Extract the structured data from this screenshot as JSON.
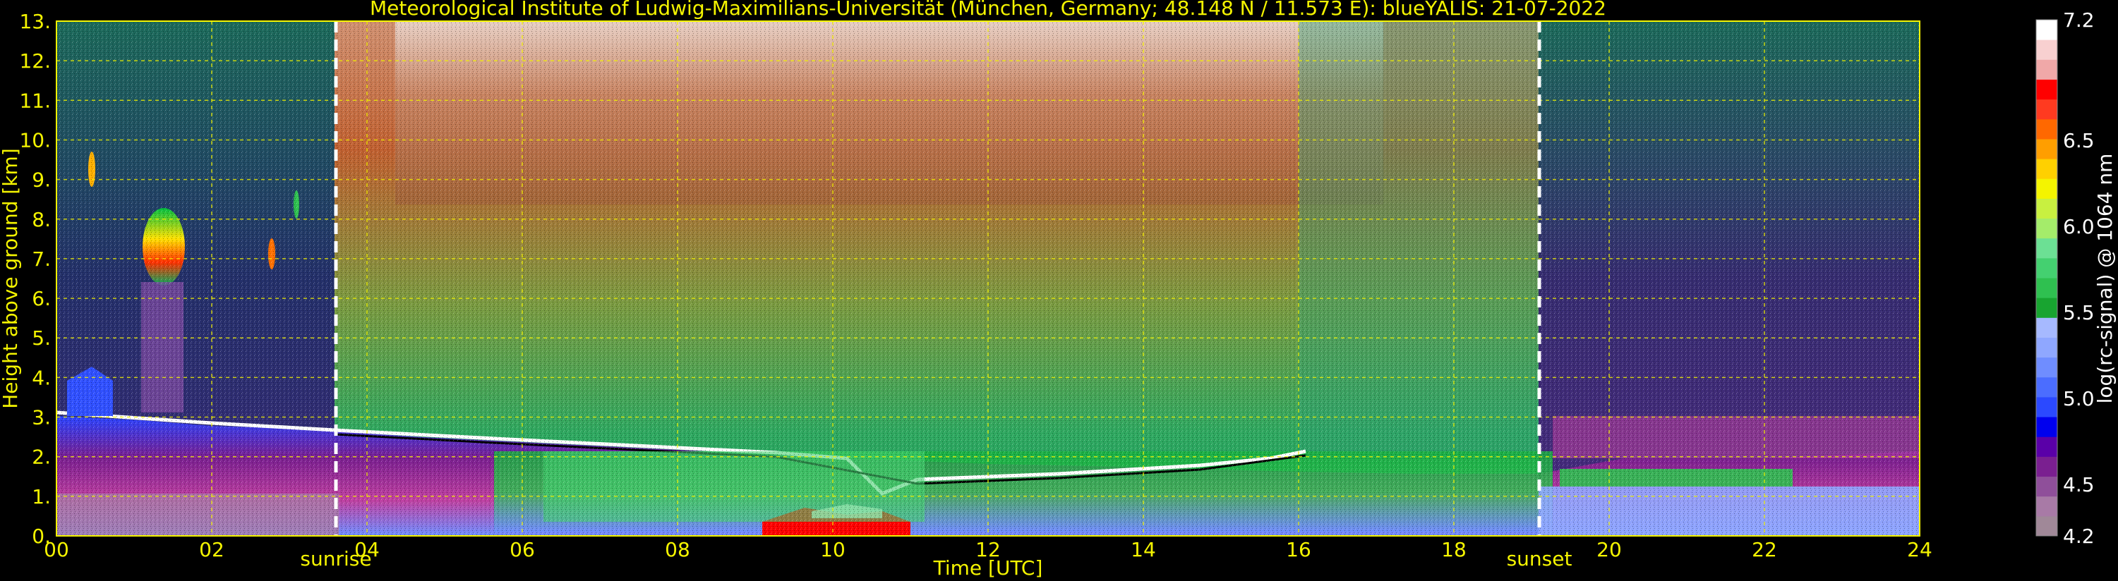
{
  "chart_data": {
    "type": "heatmap",
    "title": "Meteorological Institute of Ludwig-Maximilians-Universität (München, Germany; 48.148 N / 11.573 E):     blueYALIS: 21-07-2022",
    "xlabel": "Time [UTC]",
    "ylabel": "Height above ground [km]",
    "xlim": [
      0,
      24
    ],
    "ylim": [
      0,
      13
    ],
    "x_ticks": [
      "00",
      "02",
      "04",
      "06",
      "08",
      "10",
      "12",
      "14",
      "16",
      "18",
      "20",
      "22",
      "24"
    ],
    "x_tick_values": [
      0,
      2,
      4,
      6,
      8,
      10,
      12,
      14,
      16,
      18,
      20,
      22,
      24
    ],
    "y_ticks": [
      "0.",
      "1.",
      "2.",
      "3.",
      "4.",
      "5.",
      "6.",
      "7.",
      "8.",
      "9.",
      "10.",
      "11.",
      "12.",
      "13."
    ],
    "y_tick_values": [
      0,
      1,
      2,
      3,
      4,
      5,
      6,
      7,
      8,
      9,
      10,
      11,
      12,
      13
    ],
    "grid": true,
    "grid_style": "dashed",
    "annotations": [
      {
        "label": "sunrise",
        "x": 3.6
      },
      {
        "label": "sunset",
        "x": 19.1
      }
    ],
    "colorbar": {
      "label": "log(rc-signal) @ 1064 nm",
      "min": 4.2,
      "max": 7.2,
      "ticks": [
        "4.2",
        "4.5",
        "5.0",
        "5.5",
        "6.0",
        "6.5",
        "7.2"
      ],
      "tick_values": [
        4.2,
        4.5,
        5.0,
        5.5,
        6.0,
        6.5,
        7.2
      ],
      "colors": [
        "#a08898",
        "#a87aa6",
        "#8f4f9a",
        "#7a1f90",
        "#5a00a8",
        "#0000ee",
        "#2b49ff",
        "#4b6dff",
        "#6f8dff",
        "#8fa7ff",
        "#a6b9ff",
        "#18a430",
        "#2fc050",
        "#44d070",
        "#6ce094",
        "#a4ec6a",
        "#c8f040",
        "#f4f400",
        "#ffd000",
        "#ff9e00",
        "#ff6800",
        "#ff3a20",
        "#ff0000",
        "#f0a8a8",
        "#f8d0d0",
        "#ffffff"
      ]
    },
    "features": [
      {
        "name": "boundary-layer-top",
        "x": [
          0,
          2,
          3.6,
          6,
          8,
          10,
          11,
          12,
          14,
          16,
          16.5
        ],
        "y": [
          3.0,
          2.8,
          2.6,
          2.4,
          2.2,
          2.1,
          1.4,
          1.6,
          1.8,
          2.0,
          2.3
        ]
      },
      {
        "name": "mid-level-cloud",
        "x": [
          1.1,
          1.3,
          1.5,
          1.7
        ],
        "y": [
          6.9,
          7.5,
          7.8,
          7.3
        ]
      },
      {
        "name": "cloud-base-near-surface",
        "x": [
          9.0,
          10.0,
          10.8
        ],
        "y": [
          0.4,
          0.2,
          0.5
        ]
      }
    ]
  }
}
